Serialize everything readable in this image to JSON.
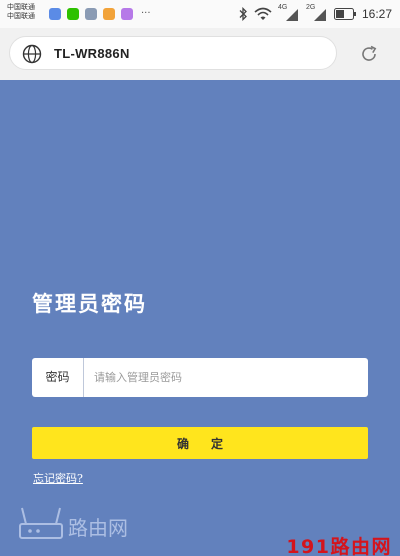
{
  "status_bar": {
    "carrier_1": "中国联通",
    "carrier_2": "中国联通",
    "more": "···",
    "network_1": "4G",
    "network_2": "2G",
    "time": "16:27"
  },
  "browser": {
    "url": "TL-WR886N"
  },
  "page": {
    "title": "管理员密码",
    "password_label": "密码",
    "password_placeholder": "请输入管理员密码",
    "password_value": "",
    "confirm_label": "确定",
    "forgot_link": "忘记密码?"
  },
  "watermark": {
    "logo_text": "路由网",
    "text": "191路由网"
  },
  "colors": {
    "page_background": "#6281BD",
    "button": "#FFE51D",
    "watermark": "#D4141C"
  }
}
